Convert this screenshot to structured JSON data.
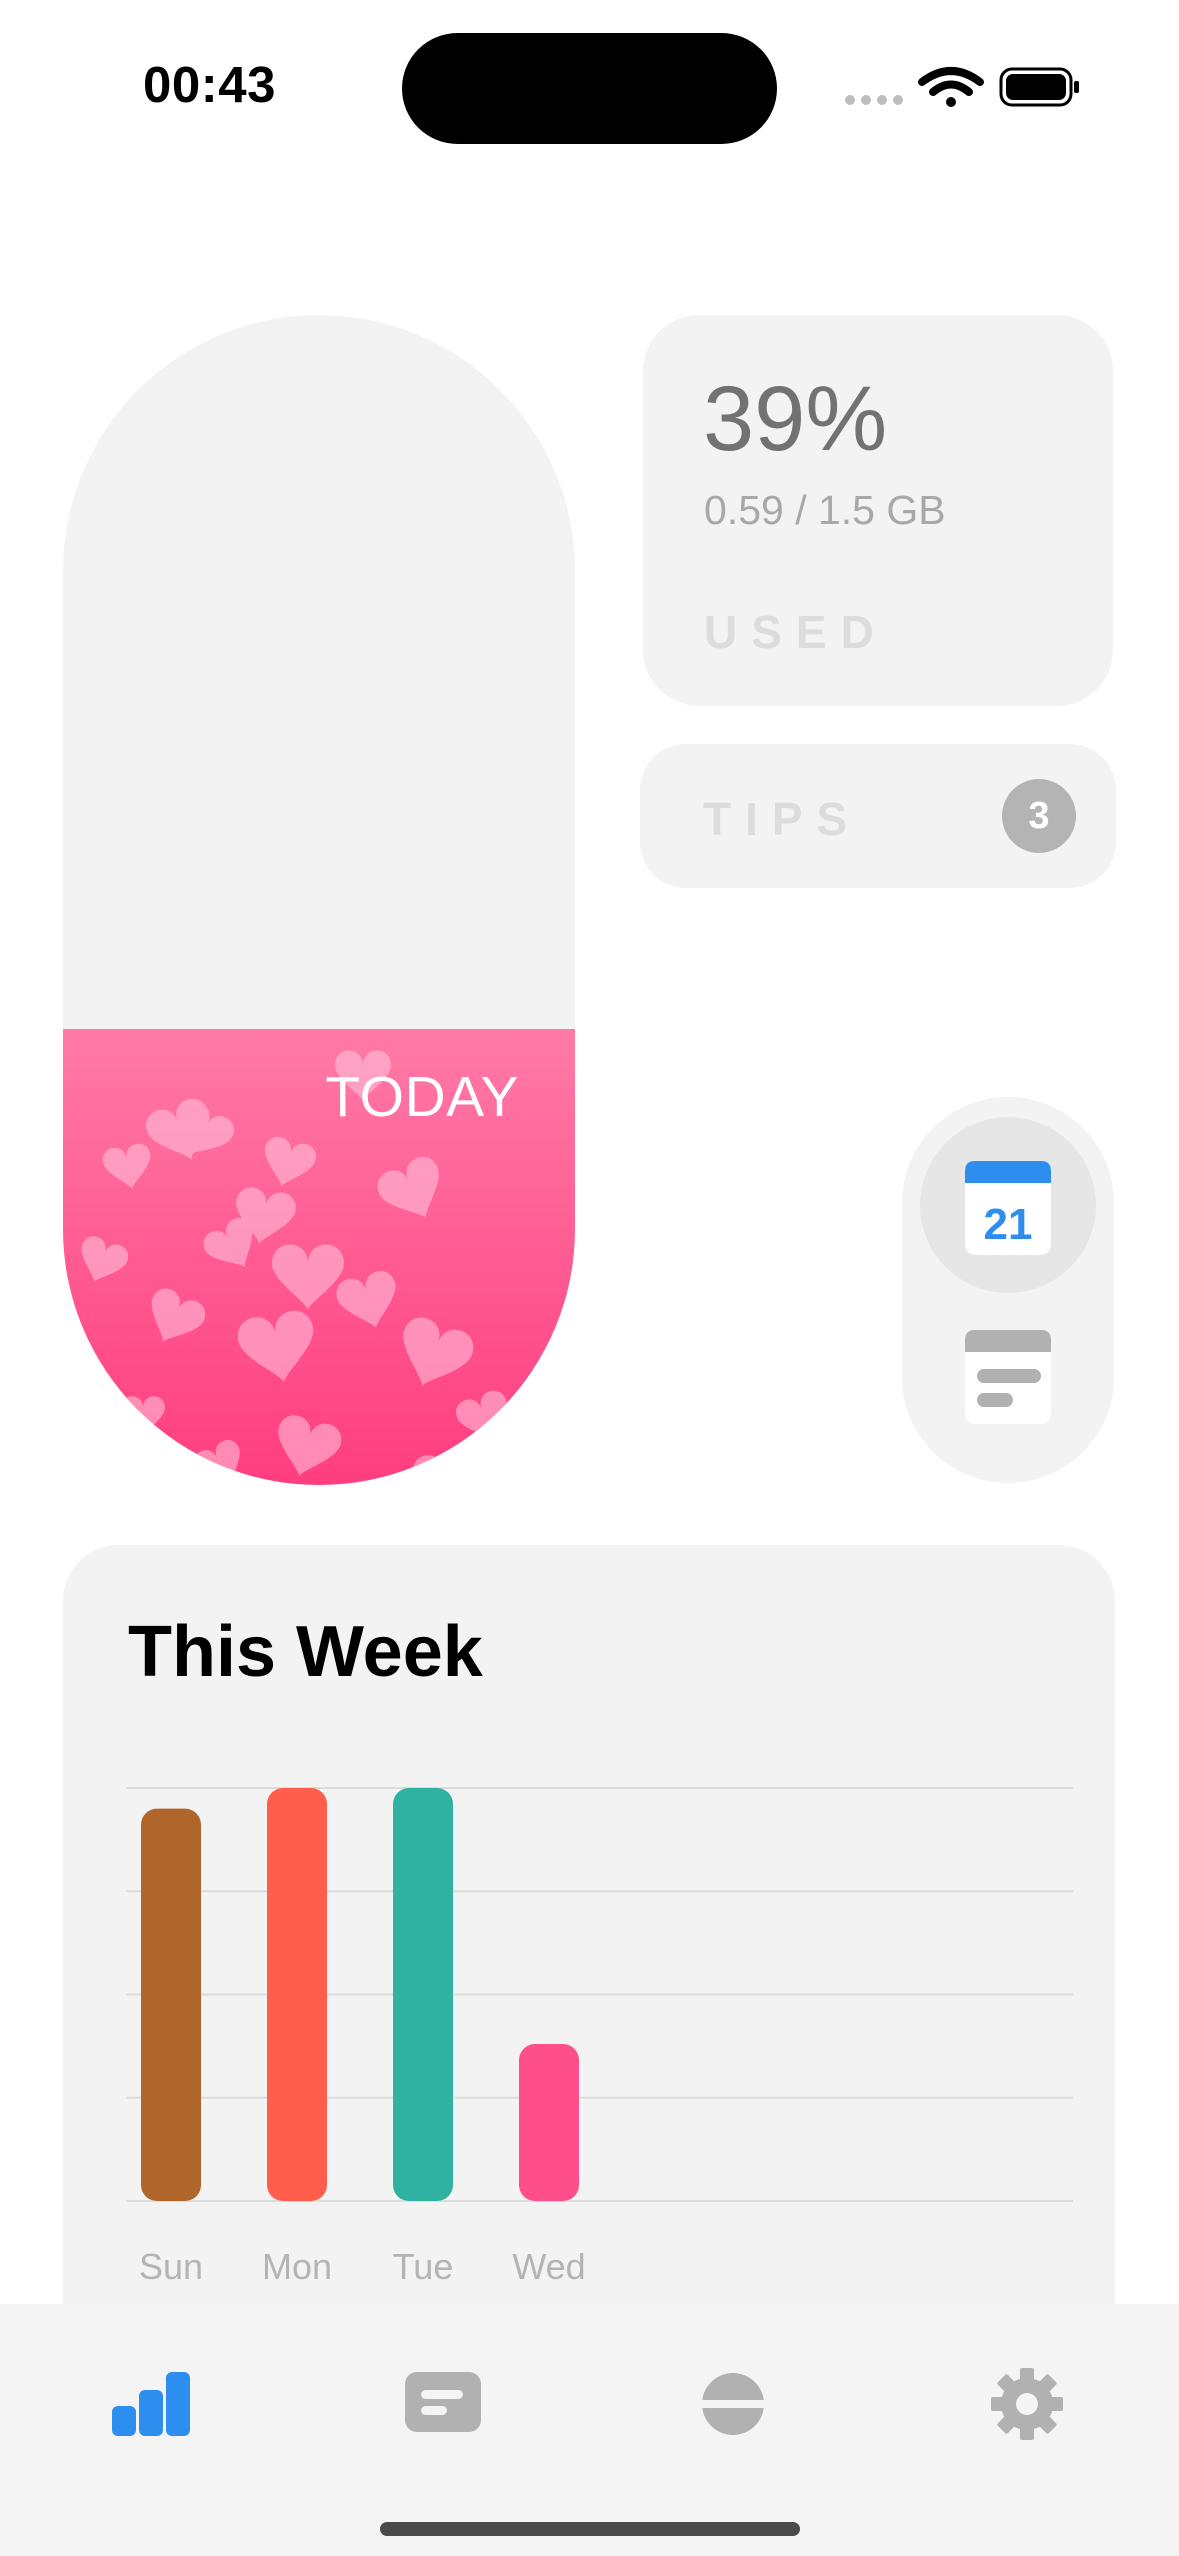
{
  "status_bar": {
    "time": "00:43"
  },
  "today": {
    "label": "TODAY",
    "fill_fraction": 0.39,
    "fill_color": "#ff4f8b"
  },
  "usage": {
    "percent": "39%",
    "amount": "0.59 / 1.5 GB",
    "label": "USED"
  },
  "tips": {
    "label": "TIPS",
    "count": "3"
  },
  "side_toggle": {
    "calendar_day": "21",
    "active": "calendar-icon"
  },
  "week": {
    "title": "This Week"
  },
  "chart_data": {
    "type": "bar",
    "categories": [
      "Sun",
      "Mon",
      "Tue",
      "Wed"
    ],
    "values": [
      0.95,
      1.0,
      1.0,
      0.38
    ],
    "colors": [
      "#b0662a",
      "#ff5e4d",
      "#2fb3a0",
      "#ff4f8b"
    ],
    "ylim": [
      0,
      1
    ],
    "grid": true
  },
  "tab_bar": {
    "tabs": [
      {
        "icon": "bar-chart-icon",
        "active": true
      },
      {
        "icon": "message-icon",
        "active": false
      },
      {
        "icon": "pill-icon",
        "active": false
      },
      {
        "icon": "gear-icon",
        "active": false
      }
    ],
    "active_color": "#2e8ef0",
    "inactive_color": "#b1b1b1"
  }
}
